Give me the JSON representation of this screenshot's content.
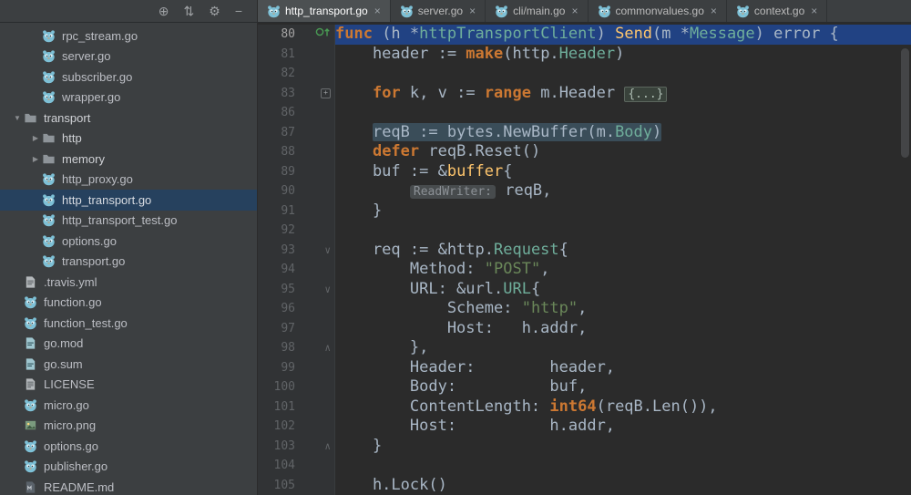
{
  "colors": {
    "editor_bg": "#2b2b2b",
    "panel_bg": "#3c3f41",
    "selection_line": "#214283",
    "tree_selection": "#26415e",
    "keyword": "#cc7832",
    "function": "#ffc66d",
    "string": "#6a8759",
    "type": "#6fae9b",
    "gutter_marker_green": "#499c54"
  },
  "glyphs": {
    "close": "×",
    "arrow_down": "▼",
    "arrow_right": "▶",
    "fold_open": "∨",
    "fold_close": "∧",
    "fold_plus": "+"
  },
  "panelHeader": {
    "icons": [
      {
        "name": "locate-icon",
        "glyph": "⊕"
      },
      {
        "name": "sort-icon",
        "glyph": "⇅"
      },
      {
        "name": "settings-gear-icon",
        "glyph": "⚙"
      },
      {
        "name": "hide-panel-icon",
        "glyph": "−"
      }
    ]
  },
  "tabs": [
    {
      "label": "http_transport.go",
      "active": true
    },
    {
      "label": "server.go",
      "active": false
    },
    {
      "label": "cli/main.go",
      "active": false
    },
    {
      "label": "commonvalues.go",
      "active": false
    },
    {
      "label": "context.go",
      "active": false
    }
  ],
  "tree": [
    {
      "label": "rpc_stream.go",
      "icon": "go",
      "indent": 2,
      "arrow": ""
    },
    {
      "label": "server.go",
      "icon": "go",
      "indent": 2,
      "arrow": ""
    },
    {
      "label": "subscriber.go",
      "icon": "go",
      "indent": 2,
      "arrow": ""
    },
    {
      "label": "wrapper.go",
      "icon": "go",
      "indent": 2,
      "arrow": ""
    },
    {
      "label": "transport",
      "icon": "folder",
      "indent": 1,
      "arrow": "down"
    },
    {
      "label": "http",
      "icon": "folder",
      "indent": 2,
      "arrow": "right"
    },
    {
      "label": "memory",
      "icon": "folder",
      "indent": 2,
      "arrow": "right"
    },
    {
      "label": "http_proxy.go",
      "icon": "go",
      "indent": 2,
      "arrow": ""
    },
    {
      "label": "http_transport.go",
      "icon": "go",
      "indent": 2,
      "arrow": "",
      "selected": true
    },
    {
      "label": "http_transport_test.go",
      "icon": "go",
      "indent": 2,
      "arrow": ""
    },
    {
      "label": "options.go",
      "icon": "go",
      "indent": 2,
      "arrow": ""
    },
    {
      "label": "transport.go",
      "icon": "go",
      "indent": 2,
      "arrow": ""
    },
    {
      "label": ".travis.yml",
      "icon": "yml",
      "indent": 1,
      "arrow": ""
    },
    {
      "label": "function.go",
      "icon": "go",
      "indent": 1,
      "arrow": ""
    },
    {
      "label": "function_test.go",
      "icon": "go",
      "indent": 1,
      "arrow": ""
    },
    {
      "label": "go.mod",
      "icon": "mod",
      "indent": 1,
      "arrow": ""
    },
    {
      "label": "go.sum",
      "icon": "mod",
      "indent": 1,
      "arrow": ""
    },
    {
      "label": "LICENSE",
      "icon": "txt",
      "indent": 1,
      "arrow": ""
    },
    {
      "label": "micro.go",
      "icon": "go",
      "indent": 1,
      "arrow": ""
    },
    {
      "label": "micro.png",
      "icon": "img",
      "indent": 1,
      "arrow": ""
    },
    {
      "label": "options.go",
      "icon": "go",
      "indent": 1,
      "arrow": ""
    },
    {
      "label": "publisher.go",
      "icon": "go",
      "indent": 1,
      "arrow": ""
    },
    {
      "label": "README.md",
      "icon": "md",
      "indent": 1,
      "arrow": ""
    }
  ],
  "editor": {
    "lines": [
      {
        "n": "80",
        "g": "override",
        "sel": true,
        "seg": [
          [
            "func",
            "kw"
          ],
          [
            " (h *",
            "p"
          ],
          [
            "httpTransportClient",
            "typ"
          ],
          [
            ") ",
            "p"
          ],
          [
            "Send",
            "fn"
          ],
          [
            "(m *",
            "p"
          ],
          [
            "Message",
            "typ"
          ],
          [
            ") error {",
            "p"
          ]
        ]
      },
      {
        "n": "81",
        "seg": [
          [
            "    header := ",
            "p"
          ],
          [
            "make",
            "kw"
          ],
          [
            "(http.",
            "p"
          ],
          [
            "Header",
            "typ"
          ],
          [
            ")",
            "p"
          ]
        ]
      },
      {
        "n": "82",
        "seg": []
      },
      {
        "n": "83",
        "g": "fold-plus",
        "seg": [
          [
            "    ",
            "p"
          ],
          [
            "for",
            "kw"
          ],
          [
            " k, v := ",
            "p"
          ],
          [
            "range",
            "kw"
          ],
          [
            " m.Header ",
            "p"
          ],
          [
            "{...}",
            "fold"
          ]
        ]
      },
      {
        "n": "86",
        "seg": []
      },
      {
        "n": "87",
        "band": true,
        "seg": [
          [
            "    ",
            "ind"
          ],
          [
            "reqB := bytes.NewBuffer(m.",
            "p"
          ],
          [
            "Body",
            "typ"
          ],
          [
            ")",
            "p"
          ]
        ]
      },
      {
        "n": "88",
        "seg": [
          [
            "    ",
            "p"
          ],
          [
            "defer",
            "kw"
          ],
          [
            " reqB.Reset()",
            "p"
          ]
        ]
      },
      {
        "n": "89",
        "seg": [
          [
            "    buf := &",
            "p"
          ],
          [
            "buffer",
            "fn"
          ],
          [
            "{",
            "p"
          ]
        ]
      },
      {
        "n": "90",
        "seg": [
          [
            "        ",
            "p"
          ],
          [
            "ReadWriter:",
            "hint"
          ],
          [
            " reqB,",
            "p"
          ]
        ]
      },
      {
        "n": "91",
        "seg": [
          [
            "    }",
            "p"
          ]
        ]
      },
      {
        "n": "92",
        "seg": []
      },
      {
        "n": "93",
        "g": "fold-open",
        "seg": [
          [
            "    req := &http.",
            "p"
          ],
          [
            "Request",
            "typ"
          ],
          [
            "{",
            "p"
          ]
        ]
      },
      {
        "n": "94",
        "seg": [
          [
            "        Method: ",
            "p"
          ],
          [
            "\"POST\"",
            "str"
          ],
          [
            ",",
            "p"
          ]
        ]
      },
      {
        "n": "95",
        "g": "fold-open",
        "seg": [
          [
            "        URL: &url.",
            "p"
          ],
          [
            "URL",
            "typ"
          ],
          [
            "{",
            "p"
          ]
        ]
      },
      {
        "n": "96",
        "seg": [
          [
            "            Scheme: ",
            "p"
          ],
          [
            "\"http\"",
            "str"
          ],
          [
            ",",
            "p"
          ]
        ]
      },
      {
        "n": "97",
        "seg": [
          [
            "            Host:   h.addr,",
            "p"
          ]
        ]
      },
      {
        "n": "98",
        "g": "fold-close",
        "seg": [
          [
            "        },",
            "p"
          ]
        ]
      },
      {
        "n": "99",
        "seg": [
          [
            "        Header:        header,",
            "p"
          ]
        ]
      },
      {
        "n": "100",
        "seg": [
          [
            "        Body:          buf,",
            "p"
          ]
        ]
      },
      {
        "n": "101",
        "seg": [
          [
            "        ContentLength: ",
            "p"
          ],
          [
            "int64",
            "kw"
          ],
          [
            "(reqB.Len()),",
            "p"
          ]
        ]
      },
      {
        "n": "102",
        "seg": [
          [
            "        Host:          h.addr,",
            "p"
          ]
        ]
      },
      {
        "n": "103",
        "g": "fold-close",
        "seg": [
          [
            "    }",
            "p"
          ]
        ]
      },
      {
        "n": "104",
        "seg": []
      },
      {
        "n": "105",
        "seg": [
          [
            "    h.Lock()",
            "p"
          ]
        ]
      }
    ]
  }
}
